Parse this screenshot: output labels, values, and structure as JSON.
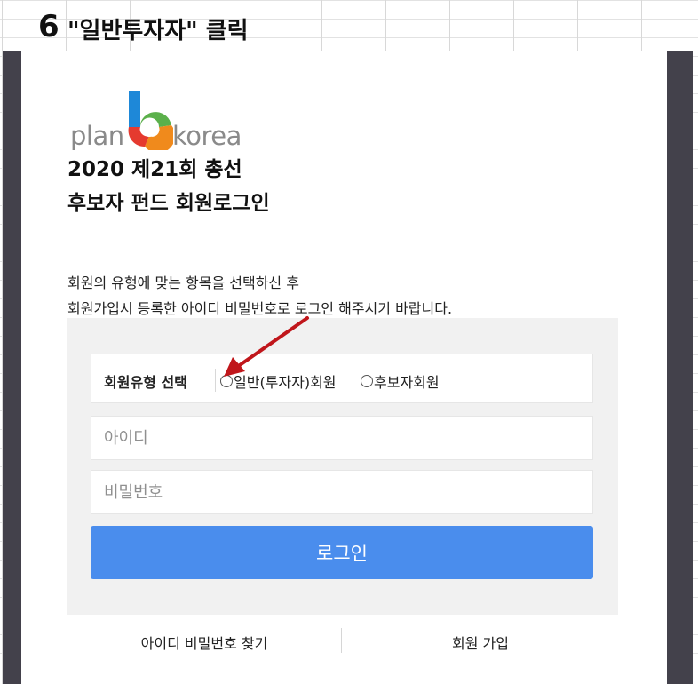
{
  "step": {
    "number": "6",
    "text": "\"일반투자자\" 클릭"
  },
  "logo": {
    "left_text": "plan",
    "right_text": "korea"
  },
  "title": {
    "line1": "2020 제21회 총선",
    "line2": "후보자 펀드 회원로그인"
  },
  "description": {
    "line1": "회원의 유형에 맞는 항목을 선택하신 후",
    "line2": "회원가입시 등록한 아이디 비밀번호로 로그인 해주시기 바랍니다."
  },
  "member_type": {
    "label": "회원유형 선택",
    "options": [
      {
        "label": "일반(투자자)회원",
        "selected": false
      },
      {
        "label": "후보자회원",
        "selected": false
      }
    ]
  },
  "fields": {
    "id_placeholder": "아이디",
    "password_placeholder": "비밀번호"
  },
  "login_button": "로그인",
  "links": {
    "find": "아이디 비밀번호 찾기",
    "join": "회원 가입"
  },
  "colors": {
    "accent_button": "#4a8ded",
    "annotation_arrow": "#c0161b",
    "frame": "#43414b",
    "logo_blue": "#1e88d8",
    "logo_orange": "#f08a1c",
    "logo_green": "#5bb04b",
    "logo_red": "#e53a2f"
  }
}
